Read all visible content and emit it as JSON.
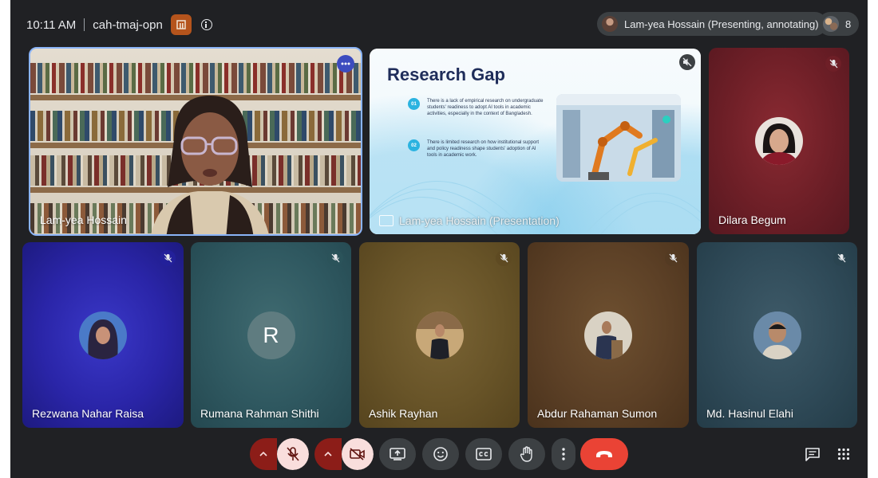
{
  "meeting": {
    "time": "10:11 AM",
    "code": "cah-tmaj-opn",
    "presenter_status": "Lam-yea Hossain (Presenting, annotating)",
    "participant_count": "8"
  },
  "tiles": {
    "speaker": {
      "name": "Lam-yea Hossain"
    },
    "presentation": {
      "label": "Lam-yea Hossain (Presentation)",
      "slide_title": "Research Gap",
      "points": [
        {
          "num": "01",
          "text": "There is a lack of empirical research on undergraduate students' readiness to adopt AI tools in academic activities, especially in the context of Bangladesh."
        },
        {
          "num": "02",
          "text": "There is limited research on how institutional support and policy readiness shape students' adoption of AI tools in academic work."
        }
      ]
    },
    "dilara": {
      "name": "Dilara Begum"
    },
    "row2": [
      {
        "name": "Rezwana Nahar Raisa"
      },
      {
        "name": "Rumana Rahman Shithi",
        "initial": "R"
      },
      {
        "name": "Ashik Rayhan"
      },
      {
        "name": "Abdur Rahaman Sumon"
      },
      {
        "name": "Md. Hasinul Elahi"
      }
    ]
  },
  "colors": {
    "accent": "#8ab4f8",
    "hangup": "#ea4335",
    "muted_control": "#f9dedc"
  },
  "icons": [
    "host-controls-icon",
    "info-icon",
    "more-options-icon",
    "mic-off-icon",
    "volume-off-icon",
    "presentation-icon",
    "chevron-up-icon",
    "camera-off-icon",
    "present-screen-icon",
    "emoji-icon",
    "captions-icon",
    "raise-hand-icon",
    "more-vert-icon",
    "hang-up-icon",
    "chat-icon",
    "activities-icon"
  ]
}
